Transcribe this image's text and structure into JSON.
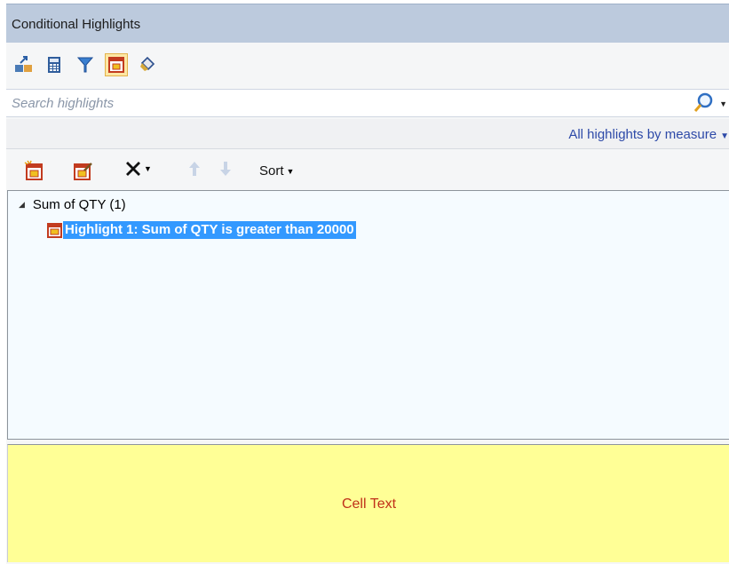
{
  "panel": {
    "title": "Conditional Highlights"
  },
  "toolbar": {
    "icons": [
      {
        "name": "add-highlight-icon"
      },
      {
        "name": "calculator-icon"
      },
      {
        "name": "filter-icon"
      },
      {
        "name": "highlight-icon",
        "active": true
      },
      {
        "name": "paint-bucket-icon"
      }
    ]
  },
  "search": {
    "placeholder": "Search highlights"
  },
  "filter": {
    "mode_label": "All highlights by measure"
  },
  "actions": {
    "sort_label": "Sort"
  },
  "tree": {
    "group": {
      "label": "Sum of QTY (1)",
      "items": [
        {
          "label": "Highlight 1: Sum of QTY is greater than 20000",
          "selected": true
        }
      ]
    }
  },
  "preview": {
    "cell_text": "Cell Text",
    "background": "#ffff96",
    "text_color": "#c0301a"
  },
  "colors": {
    "titlebar": "#bccadd",
    "selection": "#3399ff",
    "link": "#2e4aa8"
  }
}
